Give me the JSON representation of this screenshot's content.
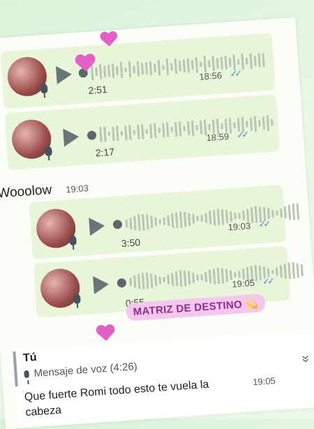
{
  "messages": [
    {
      "duration": "2:51",
      "time": "18:56",
      "ticks": "✓✓"
    },
    {
      "duration": "2:17",
      "time": "18:59",
      "ticks": "✓✓"
    },
    {
      "text": "Wooolow",
      "time": "19:03"
    },
    {
      "duration": "3:50",
      "time": "19:03",
      "ticks": "✓✓"
    },
    {
      "duration": "0:55",
      "time": "19:05",
      "ticks": "✓✓"
    }
  ],
  "badge": {
    "text": "MATRIZ DE DESTINO",
    "emoji": "💫"
  },
  "reply": {
    "author": "Tú",
    "quoted": "Mensaje de voz (4:26)",
    "text": "Que fuerte Romi todo esto te vuela la cabeza",
    "time": "19:05",
    "chevron": "«"
  },
  "colors": {
    "bubble": "#e8f5d9",
    "tick": "#4a90d9",
    "badge_bg": "#f6c7ee",
    "badge_text": "#8b2f8b",
    "heart": "#e45fc6"
  },
  "icons": [
    "play-icon",
    "microphone-icon",
    "double-check-icon",
    "heart-sticker-icon"
  ]
}
